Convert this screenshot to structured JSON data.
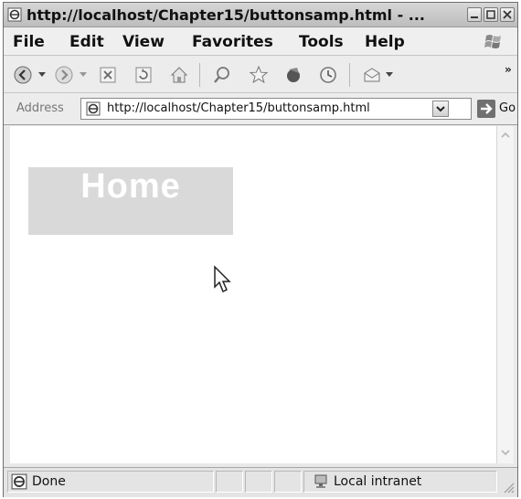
{
  "window": {
    "title": "http://localhost/Chapter15/buttonsamp.html - ...",
    "controls": [
      "minimize",
      "maximize",
      "close"
    ]
  },
  "menu": {
    "items": [
      "File",
      "Edit",
      "View",
      "Favorites",
      "Tools",
      "Help"
    ]
  },
  "toolbar": {
    "buttons": [
      "back-icon",
      "forward-icon",
      "stop-icon",
      "refresh-icon",
      "home-icon",
      "search-icon",
      "favorites-icon",
      "media-icon",
      "history-icon",
      "mail-icon"
    ],
    "overflow": "»"
  },
  "address": {
    "label": "Address",
    "url": "http://localhost/Chapter15/buttonsamp.html",
    "go_label": "Go"
  },
  "page": {
    "home_button_label": "Home",
    "home_button_color": "#d9d9d9"
  },
  "status": {
    "left_text": "Done",
    "zone_text": "Local intranet"
  }
}
